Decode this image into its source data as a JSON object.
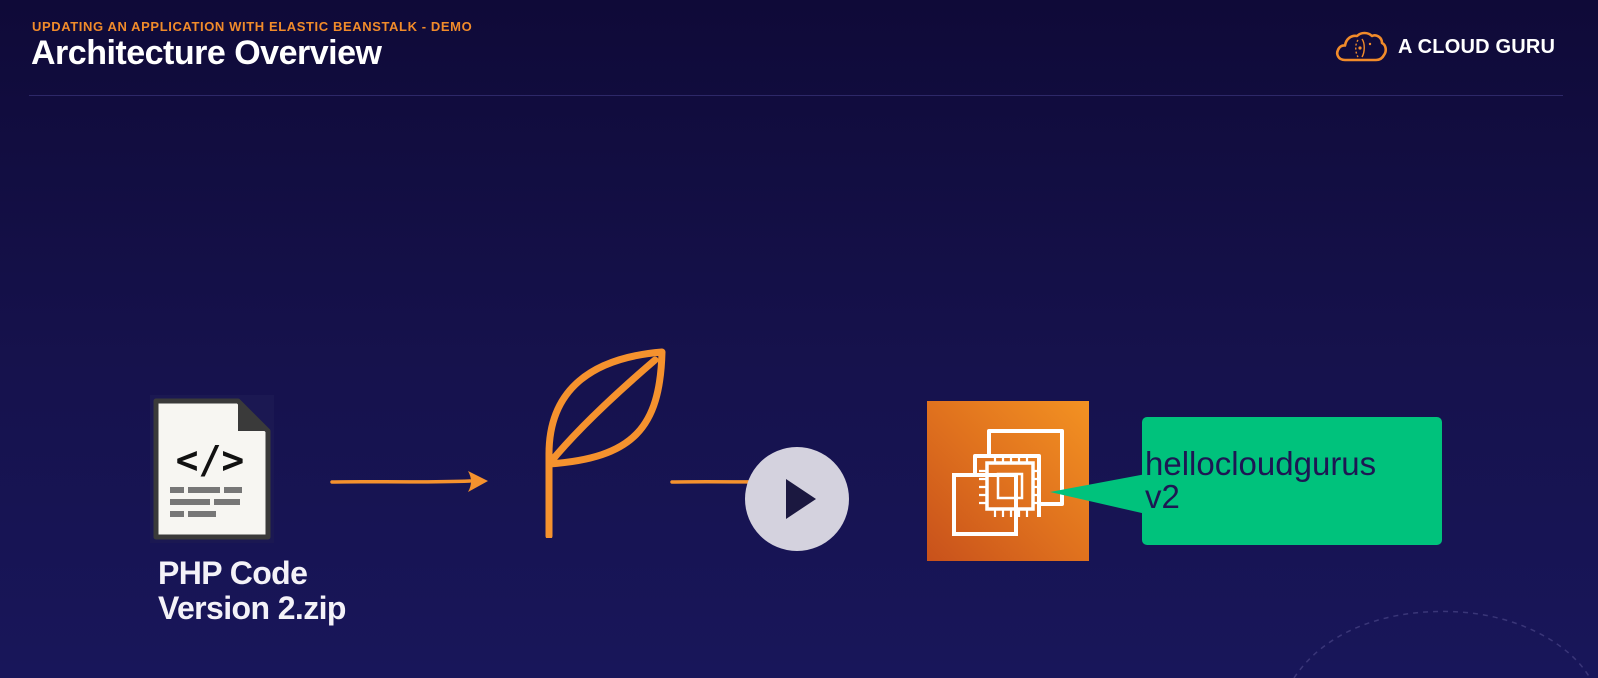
{
  "header": {
    "subtitle": "UPDATING AN APPLICATION WITH ELASTIC BEANSTALK - DEMO",
    "title": "Architecture Overview"
  },
  "brand": {
    "name": "A CLOUD GURU",
    "logo_icon": "cloud-logo-icon"
  },
  "diagram": {
    "source_file": {
      "icon": "code-file-icon",
      "code_glyph": "</>",
      "label_line1": "PHP Code",
      "label_line2": "Version 2.zip"
    },
    "service": {
      "icon": "elastic-beanstalk-leaf-icon"
    },
    "instance": {
      "icon": "ec2-instance-icon"
    },
    "callout": {
      "line1": "hellocloudgurus",
      "line2": "v2"
    }
  },
  "player": {
    "play_icon": "play-icon"
  },
  "colors": {
    "background": "#140f45",
    "accent_orange": "#f18b2a",
    "callout_green": "#00c27c",
    "callout_text": "#1d1753",
    "ec2_orange": "#e0721e"
  }
}
